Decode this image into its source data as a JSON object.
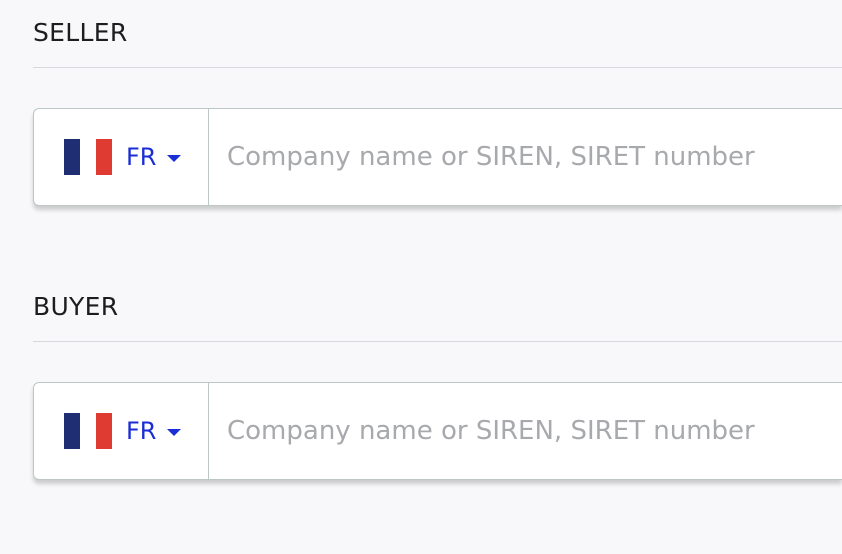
{
  "sections": {
    "seller": {
      "title": "SELLER",
      "country_code": "FR",
      "flag_icon": "france-flag-icon",
      "placeholder": "Company name or SIREN, SIRET number",
      "value": ""
    },
    "buyer": {
      "title": "BUYER",
      "country_code": "FR",
      "flag_icon": "france-flag-icon",
      "placeholder": "Company name or SIREN, SIRET number",
      "value": ""
    }
  },
  "colors": {
    "background": "#f8f8fa",
    "accent_blue": "#1a2ed6",
    "flag_blue": "#1f2d72",
    "flag_red": "#df3b33",
    "placeholder_gray": "#a7a9ad"
  }
}
